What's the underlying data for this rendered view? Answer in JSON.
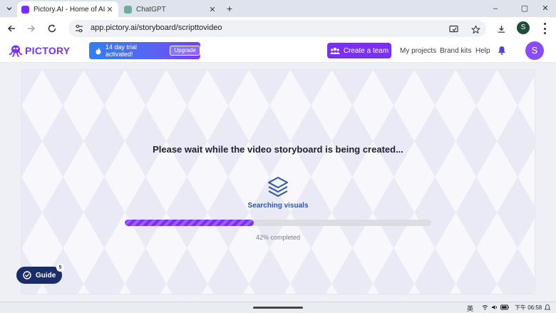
{
  "browser": {
    "tabs": [
      {
        "title": "Pictory.AI - Home of AI Vid",
        "active": true,
        "favicon_color": "#7b2ff2"
      },
      {
        "title": "ChatGPT",
        "active": false,
        "favicon_color": "#74aa9c"
      }
    ],
    "url": "app.pictory.ai/storyboard/scripttovideo",
    "profile_initial": "S",
    "window_controls": {
      "minimize": "–",
      "restore": "▢",
      "close": "✕"
    }
  },
  "header": {
    "logo_text": "PICTORY",
    "trial_text": "14 day trial activated!",
    "upgrade_label": "Upgrade",
    "create_team_label": "Create a team",
    "nav": [
      "My projects",
      "Brand kits",
      "Help"
    ],
    "avatar_initial": "S",
    "accent_color": "#7b2ff2"
  },
  "main": {
    "title": "Please wait while the video storyboard is being created...",
    "status": "Searching visuals",
    "progress": 42,
    "progress_text": "42% completed"
  },
  "guide": {
    "label": "Guide",
    "badge": "5"
  },
  "taskbar": {
    "ime": "英",
    "date": "下午",
    "time": "06:58"
  }
}
